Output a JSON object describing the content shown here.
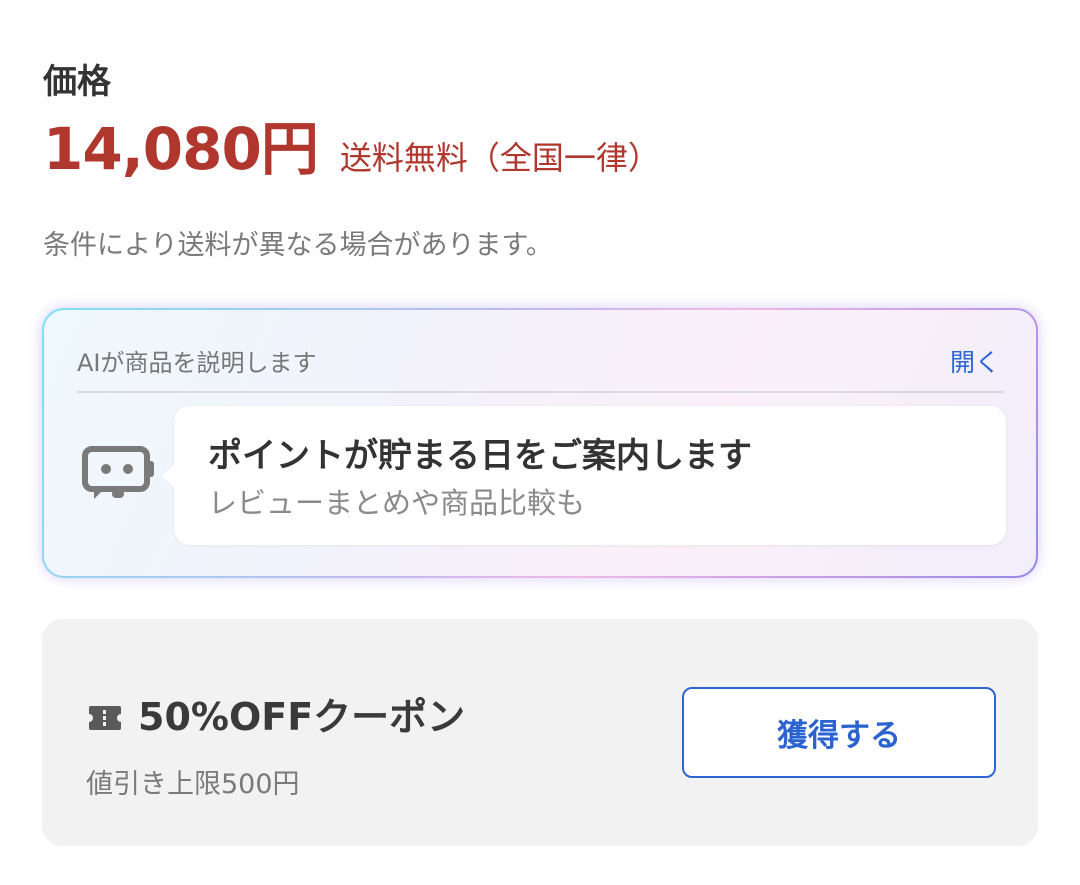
{
  "price_section": {
    "heading": "価格",
    "price": "14,080円",
    "shipping": "送料無料（全国一律）",
    "note": "条件により送料が異なる場合があります。"
  },
  "ai_panel": {
    "label": "AIが商品を説明します",
    "open_link": "開く",
    "icon": "chat-bot-icon",
    "bubble_title": "ポイントが貯まる日をご案内します",
    "bubble_subtitle": "レビューまとめや商品比較も"
  },
  "coupon": {
    "icon": "ticket-icon",
    "title": "50%OFFクーポン",
    "limit": "値引き上限500円",
    "button_label": "獲得する"
  },
  "colors": {
    "price_red": "#b0372e",
    "link_blue": "#2a66d6",
    "button_blue": "#2f64d3"
  }
}
